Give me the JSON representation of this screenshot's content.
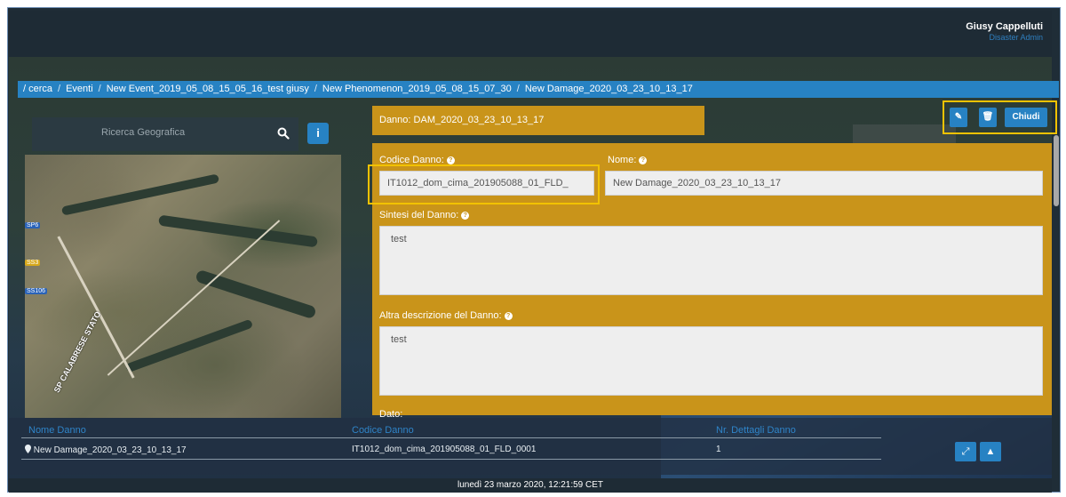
{
  "user": {
    "name": "Giusy Cappelluti",
    "role": "Disaster Admin"
  },
  "breadcrumb": [
    "/ cerca",
    "Eventi",
    "New Event_2019_05_08_15_05_16_test giusy",
    "New Phenomenon_2019_05_08_15_07_30",
    "New Damage_2020_03_23_10_13_17"
  ],
  "left_panel": {
    "search_placeholder": "Ricerca Geografica",
    "info_label": "i"
  },
  "map_labels": {
    "road_name": "SP CALABRESE STATO",
    "sign_1": "SP6",
    "sign_2": "SS3",
    "sign_3": "SS106"
  },
  "damage_header": {
    "label": "Danno:",
    "value": "DAM_2020_03_23_10_13_17"
  },
  "actions": {
    "edit_label": "✎",
    "delete_label": "🗑",
    "close_label": "Chiudi"
  },
  "form": {
    "code_label": "Codice Danno:",
    "code_value": "IT1012_dom_cima_201905088_01_FLD_",
    "name_label": "Nome:",
    "name_value": "New Damage_2020_03_23_10_13_17",
    "summary_label": "Sintesi del Danno:",
    "summary_value": "test",
    "other_desc_label": "Altra descrizione del Danno:",
    "other_desc_value": "test",
    "next_label": "Dato:"
  },
  "table": {
    "headers": [
      "Nome Danno",
      "Codice Danno",
      "Nr. Dettagli Danno"
    ],
    "rows": [
      {
        "name": "New Damage_2020_03_23_10_13_17",
        "code": "IT1012_dom_cima_201905088_01_FLD_0001",
        "count": "1"
      }
    ]
  },
  "footer": {
    "datetime": "lunedì 23 marzo 2020, 12:21:59 CET"
  },
  "colors": {
    "accent_blue": "#2782c3",
    "form_gold": "#c9941a",
    "highlight_yellow": "#f2c200",
    "header_dark": "#1e2b35"
  }
}
